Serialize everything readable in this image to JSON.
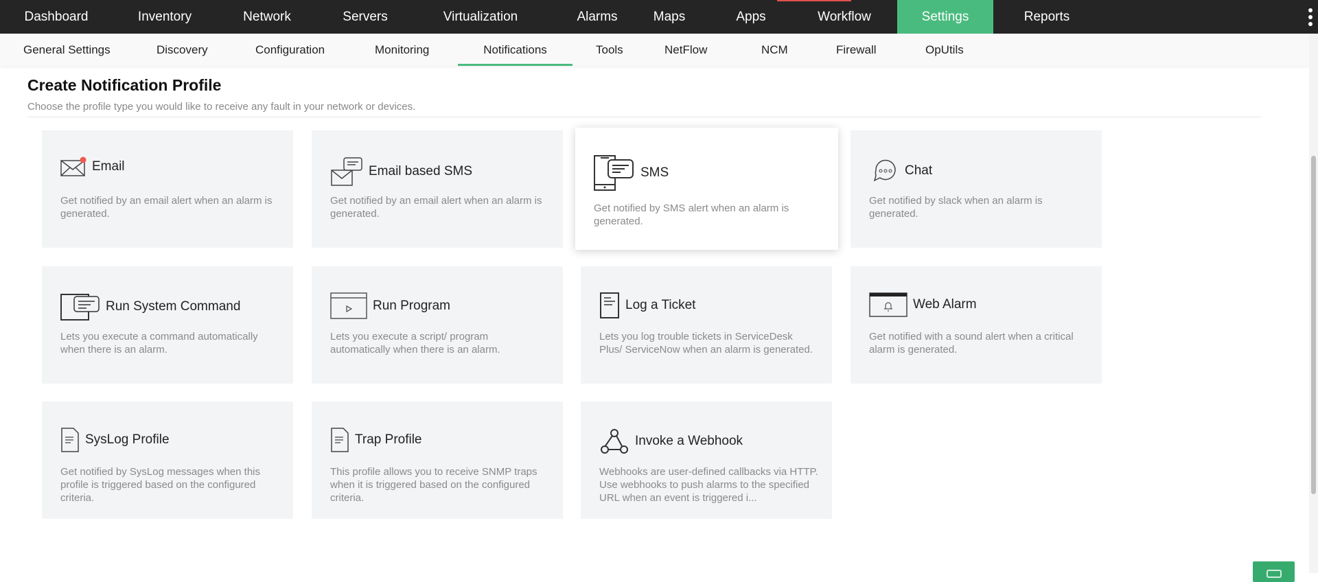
{
  "topnav": {
    "items": [
      "Dashboard",
      "Inventory",
      "Network",
      "Servers",
      "Virtualization",
      "Alarms",
      "Maps",
      "Apps",
      "Workflow",
      "Settings",
      "Reports"
    ],
    "active": "Settings"
  },
  "subnav": {
    "items": [
      "General Settings",
      "Discovery",
      "Configuration",
      "Monitoring",
      "Notifications",
      "Tools",
      "NetFlow",
      "NCM",
      "Firewall",
      "OpUtils"
    ],
    "active": "Notifications"
  },
  "page": {
    "title": "Create Notification Profile",
    "subtitle": "Choose the profile type you would like to receive any fault in your network or devices."
  },
  "cards": [
    {
      "title": "Email",
      "desc": "Get notified by an email alert when an alarm is generated.",
      "icon": "email-icon"
    },
    {
      "title": "Email based SMS",
      "desc": "Get notified by an email alert when an alarm is generated.",
      "icon": "email-sms-icon"
    },
    {
      "title": "SMS",
      "desc": "Get notified by SMS alert when an alarm is generated.",
      "icon": "sms-icon"
    },
    {
      "title": "Chat",
      "desc": "Get notified by slack when an alarm is generated.",
      "icon": "chat-icon"
    },
    {
      "title": "Run System Command",
      "desc": "Lets you execute a command automatically when there is an alarm.",
      "icon": "command-icon"
    },
    {
      "title": "Run Program",
      "desc": "Lets you execute a script/ program automatically when there is an alarm.",
      "icon": "program-icon"
    },
    {
      "title": "Log a Ticket",
      "desc": "Lets you log trouble tickets in ServiceDesk Plus/ ServiceNow when an alarm is generated.",
      "icon": "ticket-icon"
    },
    {
      "title": "Web Alarm",
      "desc": "Get notified with a sound alert when a critical alarm is generated.",
      "icon": "web-alarm-icon"
    },
    {
      "title": "SysLog Profile",
      "desc": "Get notified by SysLog messages when this profile is triggered based on the configured criteria.",
      "icon": "document-icon"
    },
    {
      "title": "Trap Profile",
      "desc": "This profile allows you to receive SNMP traps when it is triggered based on the configured criteria.",
      "icon": "document-icon"
    },
    {
      "title": "Invoke a Webhook",
      "desc": "Webhooks are user-defined callbacks via HTTP. Use webhooks to push alarms to the specified URL when an event is triggered i...",
      "icon": "webhook-icon"
    }
  ],
  "colors": {
    "accent": "#4abb7f",
    "topbar": "#252525",
    "card": "#f3f4f6"
  }
}
